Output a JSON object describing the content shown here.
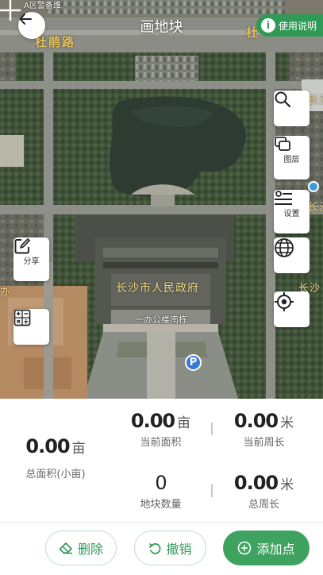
{
  "header": {
    "title": "画地块",
    "help_label": "使用说明",
    "help_icon_letter": "i"
  },
  "map": {
    "labels": {
      "top_area": "A区警备维",
      "road_left": "杜鹃路",
      "road_right": "杜",
      "gov": "长沙市人民政府",
      "building": "一办公楼南栋",
      "right_edge_1": "长沙",
      "right_edge_2": "长沙",
      "right_edge_3": "长沙",
      "left_edge": "办"
    },
    "poi_letter": "P",
    "controls": {
      "layers": "图层",
      "settings": "设置",
      "share": "分享"
    }
  },
  "stats": {
    "total_area": {
      "value": "0.00",
      "unit": "亩",
      "label": "总面积(小亩)"
    },
    "current_area": {
      "value": "0.00",
      "unit": "亩",
      "label": "当前面积"
    },
    "current_perimeter": {
      "value": "0.00",
      "unit": "米",
      "label": "当前周长"
    },
    "plot_count": {
      "value": "0",
      "label": "地块数量"
    },
    "total_perimeter": {
      "value": "0.00",
      "unit": "米",
      "label": "总周长"
    }
  },
  "actions": {
    "delete": "删除",
    "undo": "撤销",
    "add_point": "添加点"
  },
  "colors": {
    "accent": "#2e9a55",
    "accent_solid": "#3ea35f",
    "poi_blue": "#3a78d8"
  }
}
